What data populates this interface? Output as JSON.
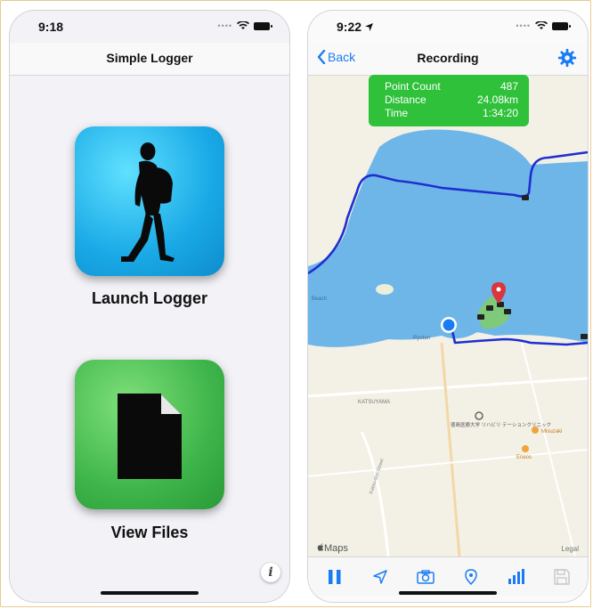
{
  "left_screen": {
    "status_time": "9:18",
    "nav_title": "Simple Logger",
    "launch_label": "Launch Logger",
    "files_label": "View Files",
    "info_glyph": "i",
    "icons": [
      "walker-icon",
      "document-icon",
      "info-icon"
    ]
  },
  "right_screen": {
    "status_time": "9:22",
    "back_label": "Back",
    "nav_title": "Recording",
    "stats": {
      "point_count_label": "Point Count",
      "point_count_value": "487",
      "distance_label": "Distance",
      "distance_value": "24.08km",
      "time_label": "Time",
      "time_value": "1:34:20"
    },
    "map_labels": {
      "katsuyama": "KATSUYAMA",
      "clinic": "徳島医療大学 リハビリ テーションクリニック",
      "misuzaki": "Misuzaki",
      "eneos": "Eneos",
      "street": "Katsu-dori Street",
      "area": "Ryotan",
      "beach": "Beach"
    },
    "maps_credit": "Maps",
    "legal": "Legal",
    "toolbar_icons": [
      "pause-icon",
      "location-arrow-icon",
      "camera-icon",
      "pin-icon",
      "chart-icon",
      "save-icon"
    ]
  },
  "colors": {
    "accent": "#1a7cf5",
    "stats_green": "#2fc13a",
    "route": "#1e2fd0",
    "water": "#6fb6e8"
  }
}
